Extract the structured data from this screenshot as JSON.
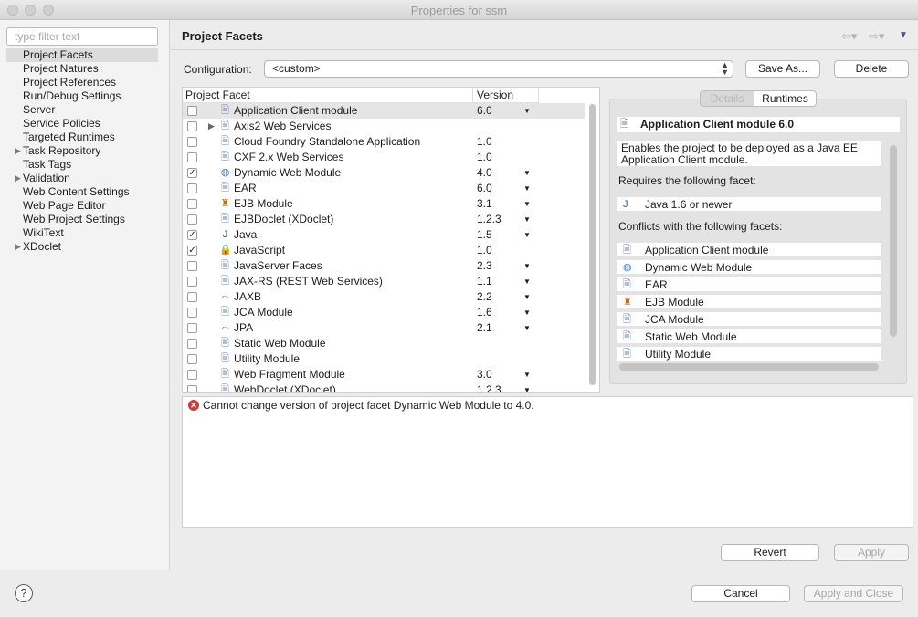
{
  "window": {
    "title": "Properties for ssm"
  },
  "sidebar": {
    "filter_placeholder": "type filter text",
    "items": [
      {
        "label": "Project Facets",
        "selected": true,
        "expandable": false
      },
      {
        "label": "Project Natures",
        "expandable": false
      },
      {
        "label": "Project References",
        "expandable": false
      },
      {
        "label": "Run/Debug Settings",
        "expandable": false
      },
      {
        "label": "Server",
        "expandable": false
      },
      {
        "label": "Service Policies",
        "expandable": false
      },
      {
        "label": "Targeted Runtimes",
        "expandable": false
      },
      {
        "label": "Task Repository",
        "expandable": true
      },
      {
        "label": "Task Tags",
        "expandable": false
      },
      {
        "label": "Validation",
        "expandable": true
      },
      {
        "label": "Web Content Settings",
        "expandable": false
      },
      {
        "label": "Web Page Editor",
        "expandable": false
      },
      {
        "label": "Web Project Settings",
        "expandable": false
      },
      {
        "label": "WikiText",
        "expandable": false
      },
      {
        "label": "XDoclet",
        "expandable": true
      }
    ]
  },
  "header": {
    "title": "Project Facets",
    "back_icon": "back-arrow-icon",
    "forward_icon": "forward-arrow-icon"
  },
  "configuration": {
    "label": "Configuration:",
    "value": "<custom>",
    "save_as_label": "Save As...",
    "delete_label": "Delete"
  },
  "facets": {
    "col_facet": "Project Facet",
    "col_version": "Version",
    "rows": [
      {
        "name": "Application Client module",
        "version": "6.0",
        "checked": false,
        "dropdown": true,
        "icon": "doc",
        "selected": true
      },
      {
        "name": "Axis2 Web Services",
        "version": "",
        "checked": false,
        "dropdown": false,
        "icon": "doc",
        "expandable": true
      },
      {
        "name": "Cloud Foundry Standalone Application",
        "version": "1.0",
        "checked": false,
        "dropdown": false,
        "icon": "doc"
      },
      {
        "name": "CXF 2.x Web Services",
        "version": "1.0",
        "checked": false,
        "dropdown": false,
        "icon": "doc"
      },
      {
        "name": "Dynamic Web Module",
        "version": "4.0",
        "checked": true,
        "dropdown": true,
        "icon": "globe"
      },
      {
        "name": "EAR",
        "version": "6.0",
        "checked": false,
        "dropdown": true,
        "icon": "doc"
      },
      {
        "name": "EJB Module",
        "version": "3.1",
        "checked": false,
        "dropdown": true,
        "icon": "bean"
      },
      {
        "name": "EJBDoclet (XDoclet)",
        "version": "1.2.3",
        "checked": false,
        "dropdown": true,
        "icon": "doc"
      },
      {
        "name": "Java",
        "version": "1.5",
        "checked": true,
        "dropdown": true,
        "icon": "java"
      },
      {
        "name": "JavaScript",
        "version": "1.0",
        "checked": true,
        "dropdown": false,
        "icon": "lock"
      },
      {
        "name": "JavaServer Faces",
        "version": "2.3",
        "checked": false,
        "dropdown": true,
        "icon": "doc"
      },
      {
        "name": "JAX-RS (REST Web Services)",
        "version": "1.1",
        "checked": false,
        "dropdown": true,
        "icon": "doc"
      },
      {
        "name": "JAXB",
        "version": "2.2",
        "checked": false,
        "dropdown": true,
        "icon": "arrows"
      },
      {
        "name": "JCA Module",
        "version": "1.6",
        "checked": false,
        "dropdown": true,
        "icon": "doc"
      },
      {
        "name": "JPA",
        "version": "2.1",
        "checked": false,
        "dropdown": true,
        "icon": "arrows"
      },
      {
        "name": "Static Web Module",
        "version": "",
        "checked": false,
        "dropdown": false,
        "icon": "doc"
      },
      {
        "name": "Utility Module",
        "version": "",
        "checked": false,
        "dropdown": false,
        "icon": "doc"
      },
      {
        "name": "Web Fragment Module",
        "version": "3.0",
        "checked": false,
        "dropdown": true,
        "icon": "doc"
      },
      {
        "name": "WebDoclet (XDoclet)",
        "version": "1.2.3",
        "checked": false,
        "dropdown": true,
        "icon": "doc"
      }
    ]
  },
  "details": {
    "tab_details": "Details",
    "tab_runtimes": "Runtimes",
    "heading": "Application Client module 6.0",
    "description": "Enables the project to be deployed as a Java EE Application Client module.",
    "requires_label": "Requires the following facet:",
    "requires": [
      {
        "name": "Java 1.6 or newer",
        "icon": "java"
      }
    ],
    "conflicts_label": "Conflicts with the following facets:",
    "conflicts": [
      {
        "name": "Application Client module",
        "icon": "doc"
      },
      {
        "name": "Dynamic Web Module",
        "icon": "globe"
      },
      {
        "name": "EAR",
        "icon": "doc"
      },
      {
        "name": "EJB Module",
        "icon": "bean"
      },
      {
        "name": "JCA Module",
        "icon": "doc"
      },
      {
        "name": "Static Web Module",
        "icon": "doc"
      },
      {
        "name": "Utility Module",
        "icon": "doc"
      }
    ]
  },
  "message": {
    "icon": "error-icon",
    "text": "Cannot change version of project facet Dynamic Web Module to 4.0."
  },
  "footer": {
    "revert_label": "Revert",
    "apply_label": "Apply",
    "cancel_label": "Cancel",
    "apply_close_label": "Apply and Close",
    "help_icon": "help-icon"
  }
}
